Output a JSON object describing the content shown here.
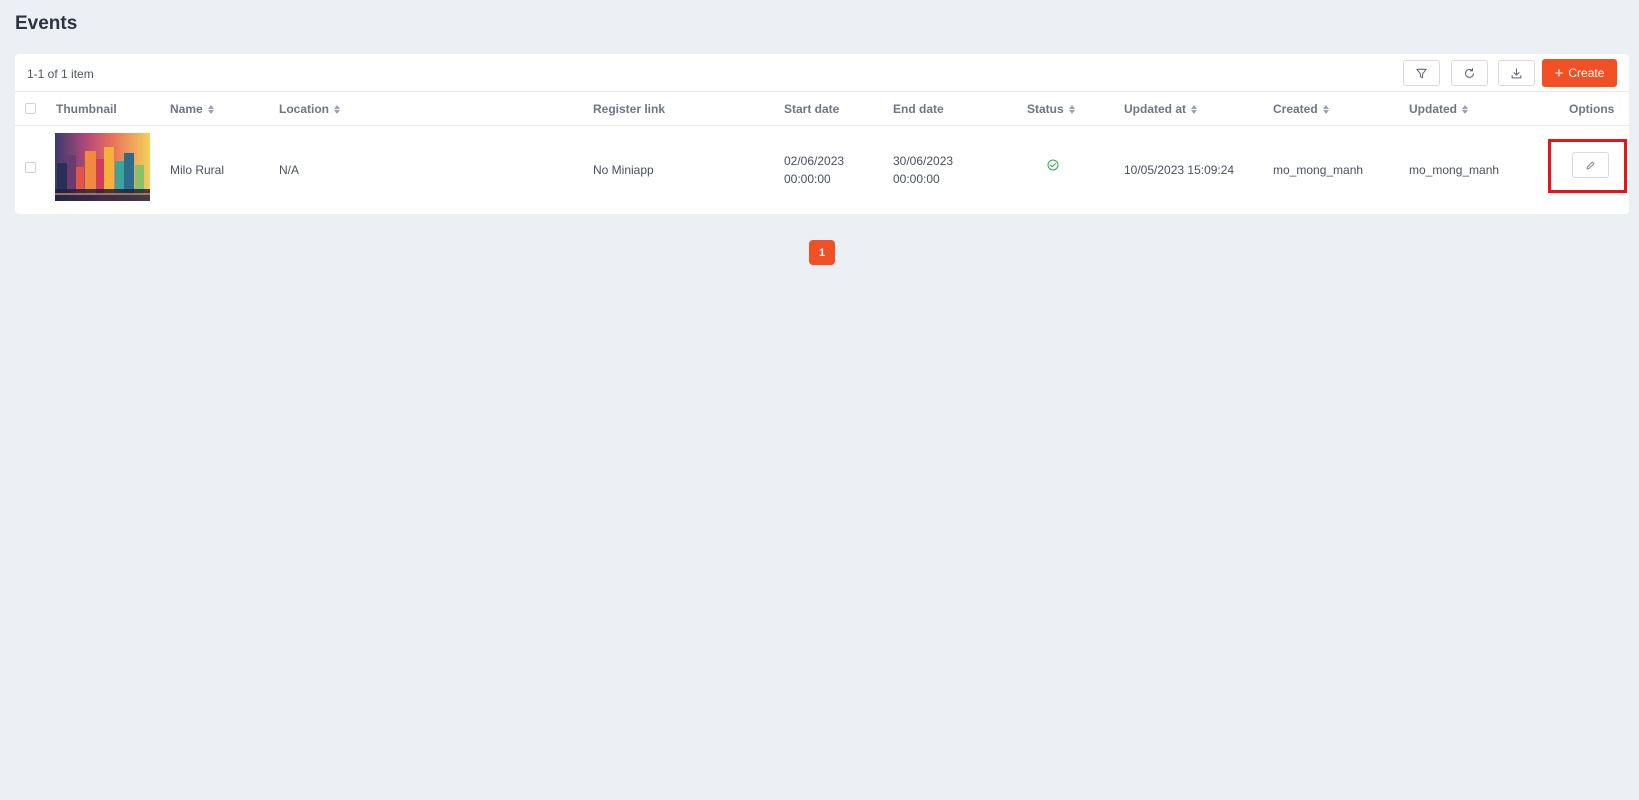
{
  "page": {
    "title": "Events"
  },
  "toolbar": {
    "item_count": "1-1 of 1 item",
    "filter_icon": "filter-icon",
    "refresh_icon": "refresh-icon",
    "download_icon": "download-icon",
    "create_label": "Create"
  },
  "table": {
    "columns": {
      "thumbnail": "Thumbnail",
      "name": "Name",
      "location": "Location",
      "register_link": "Register link",
      "start_date": "Start date",
      "end_date": "End date",
      "status": "Status",
      "updated_at": "Updated at",
      "created": "Created",
      "updated": "Updated",
      "options": "Options"
    },
    "rows": [
      {
        "name": "Milo Rural",
        "location": "N/A",
        "register_link": "No Miniapp",
        "start_date": "02/06/2023",
        "start_time": "00:00:00",
        "end_date": "30/06/2023",
        "end_time": "00:00:00",
        "status_icon": "check-circle-icon",
        "updated_at": "10/05/2023 15:09:24",
        "created": "mo_mong_manh",
        "updated": "mo_mong_manh",
        "edit_icon": "pencil-icon"
      }
    ]
  },
  "pagination": {
    "current_page": "1"
  },
  "colors": {
    "accent": "#f05023",
    "status_active": "#2eaa4f",
    "highlight": "#e8131b"
  }
}
